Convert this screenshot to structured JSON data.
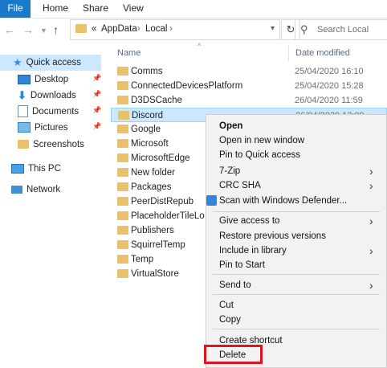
{
  "ribbon": {
    "tabs": [
      "File",
      "Home",
      "Share",
      "View"
    ]
  },
  "address": {
    "prefix": "«",
    "crumbs": [
      "AppData",
      "Local"
    ],
    "separator": "›"
  },
  "search": {
    "placeholder": "Search Local"
  },
  "nav_pane": {
    "items": [
      {
        "label": "Quick access",
        "icon": "star-icon"
      },
      {
        "label": "Desktop",
        "icon": "desktop-icon",
        "pinned": true
      },
      {
        "label": "Downloads",
        "icon": "download-icon",
        "pinned": true
      },
      {
        "label": "Documents",
        "icon": "documents-icon",
        "pinned": true
      },
      {
        "label": "Pictures",
        "icon": "pictures-icon",
        "pinned": true
      },
      {
        "label": "Screenshots",
        "icon": "folder-icon"
      },
      {
        "label": "This PC",
        "icon": "computer-icon"
      },
      {
        "label": "Network",
        "icon": "network-icon"
      }
    ]
  },
  "file_list": {
    "columns": {
      "name": "Name",
      "date": "Date modified"
    },
    "rows": [
      {
        "name": "Comms",
        "date": "25/04/2020 16:10"
      },
      {
        "name": "ConnectedDevicesPlatform",
        "date": "25/04/2020 15:28"
      },
      {
        "name": "D3DSCache",
        "date": "26/04/2020 11:59"
      },
      {
        "name": "Discord",
        "date": "26/04/2020 13:09"
      },
      {
        "name": "Google",
        "date": ""
      },
      {
        "name": "Microsoft",
        "date": ""
      },
      {
        "name": "MicrosoftEdge",
        "date": ""
      },
      {
        "name": "New folder",
        "date": ""
      },
      {
        "name": "Packages",
        "date": ""
      },
      {
        "name": "PeerDistRepub",
        "date": ""
      },
      {
        "name": "PlaceholderTileLo",
        "date": ""
      },
      {
        "name": "Publishers",
        "date": ""
      },
      {
        "name": "SquirrelTemp",
        "date": ""
      },
      {
        "name": "Temp",
        "date": ""
      },
      {
        "name": "VirtualStore",
        "date": ""
      }
    ]
  },
  "context_menu": {
    "items": [
      "Open",
      "Open in new window",
      "Pin to Quick access",
      "7-Zip",
      "CRC SHA",
      "Scan with Windows Defender...",
      "Give access to",
      "Restore previous versions",
      "Include in library",
      "Pin to Start",
      "Send to",
      "Cut",
      "Copy",
      "Create shortcut",
      "Delete"
    ]
  },
  "colors": {
    "accent": "#1979ca",
    "selection": "#cce8ff",
    "highlight_box": "#e0141e",
    "folder": "#e8c26a"
  }
}
